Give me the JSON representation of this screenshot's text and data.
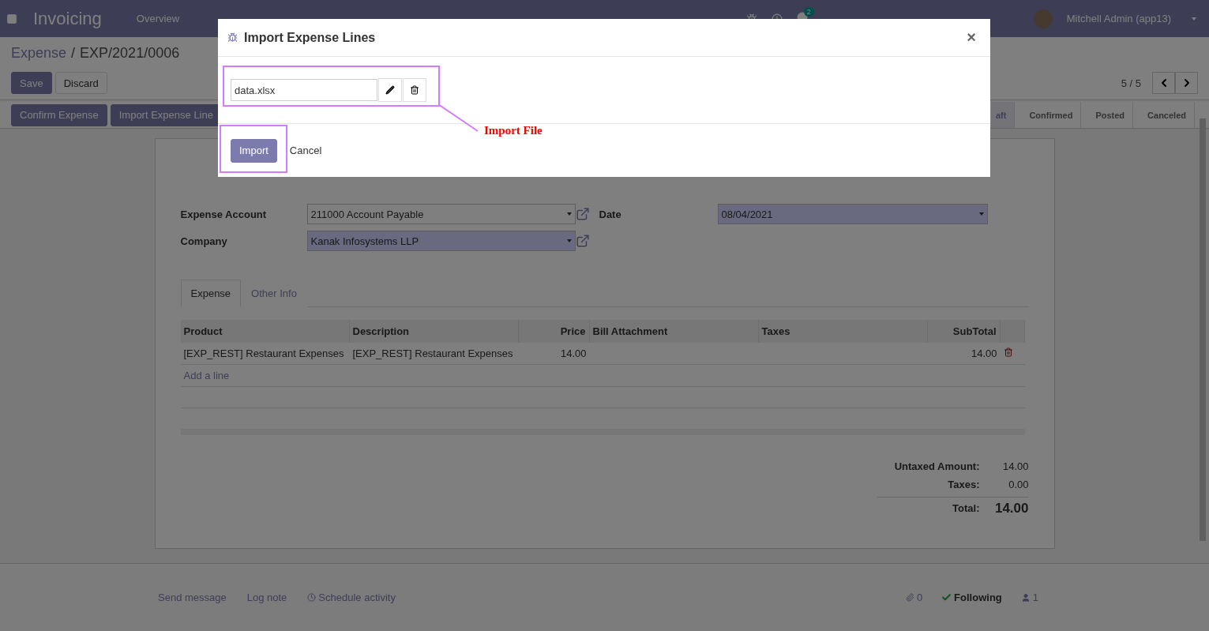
{
  "navbar": {
    "app_name": "Invoicing",
    "menu": [
      "Overview"
    ],
    "messages_badge": "2",
    "user": "Mitchell Admin (app13)"
  },
  "breadcrumb": {
    "parent": "Expense",
    "separator": "/",
    "current": "EXP/2021/0006"
  },
  "form_buttons": [
    {
      "label": "Save",
      "kind": "primary"
    },
    {
      "label": "Discard",
      "kind": "secondary"
    }
  ],
  "pager": {
    "text": "5 / 5"
  },
  "actions": [
    "Confirm Expense",
    "Import Expense Line"
  ],
  "stages": [
    {
      "label": "aft",
      "selected": true
    },
    {
      "label": "Confirmed",
      "selected": false
    },
    {
      "label": "Posted",
      "selected": false
    },
    {
      "label": "Canceled",
      "selected": false
    }
  ],
  "sheet": {
    "fields": [
      {
        "label": "Expense Account",
        "value": "211000 Account Payable",
        "required": false
      },
      {
        "label": "Company",
        "value": "Kanak Infosystems LLP",
        "required": true
      }
    ],
    "date": {
      "label": "Date",
      "value": "08/04/2021",
      "required": true
    },
    "tabs": [
      {
        "label": "Expense",
        "selected": true
      },
      {
        "label": "Other Info",
        "selected": false
      }
    ],
    "table": {
      "columns": [
        "Product",
        "Description",
        "Price",
        "Bill Attachment",
        "Taxes",
        "SubTotal"
      ],
      "rows": [
        [
          "[EXP_REST] Restaurant Expenses",
          "[EXP_REST] Restaurant Expenses",
          "14.00",
          "",
          "",
          "14.00"
        ]
      ],
      "add_line": "Add a line"
    },
    "totals": [
      {
        "label": "Untaxed Amount:",
        "value": "14.00",
        "kind": "plain"
      },
      {
        "label": "Taxes:",
        "value": "0.00",
        "kind": "plain"
      },
      {
        "label": "Total:",
        "value": "14.00",
        "kind": "grand"
      }
    ]
  },
  "chatter": {
    "send_message": "Send message",
    "log_note": "Log note",
    "schedule": "Schedule activity",
    "attachments": "0",
    "follow": "Following",
    "followers": "1"
  },
  "modal": {
    "title": "Import Expense Lines",
    "close": "×",
    "file": "data.xlsx",
    "buttons": [
      {
        "label": "Import",
        "kind": "primary"
      },
      {
        "label": "Cancel",
        "kind": "link"
      }
    ],
    "annotation": "Import File"
  }
}
